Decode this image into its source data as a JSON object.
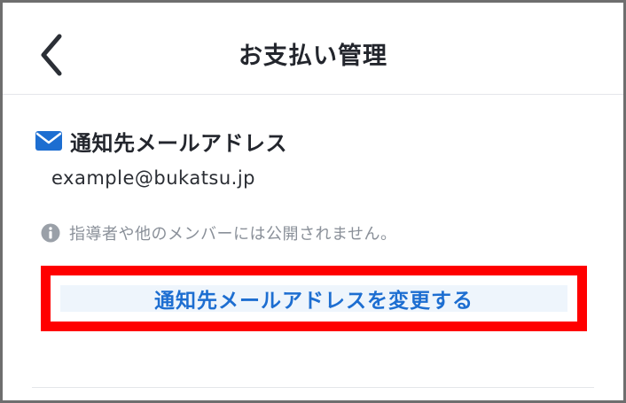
{
  "header": {
    "title": "お支払い管理",
    "back_icon": "chevron-left-icon"
  },
  "notification_email": {
    "icon": "mail-icon",
    "label": "通知先メールアドレス",
    "value": "example@bukatsu.jp",
    "notice_icon": "info-icon",
    "notice": "指導者や他のメンバーには公開されません。",
    "change_button_label": "通知先メールアドレスを変更する"
  },
  "colors": {
    "accent": "#1d6ed1",
    "button_background": "#eef5fc",
    "highlight_border": "#ff0000",
    "muted_text": "#8a9099"
  }
}
